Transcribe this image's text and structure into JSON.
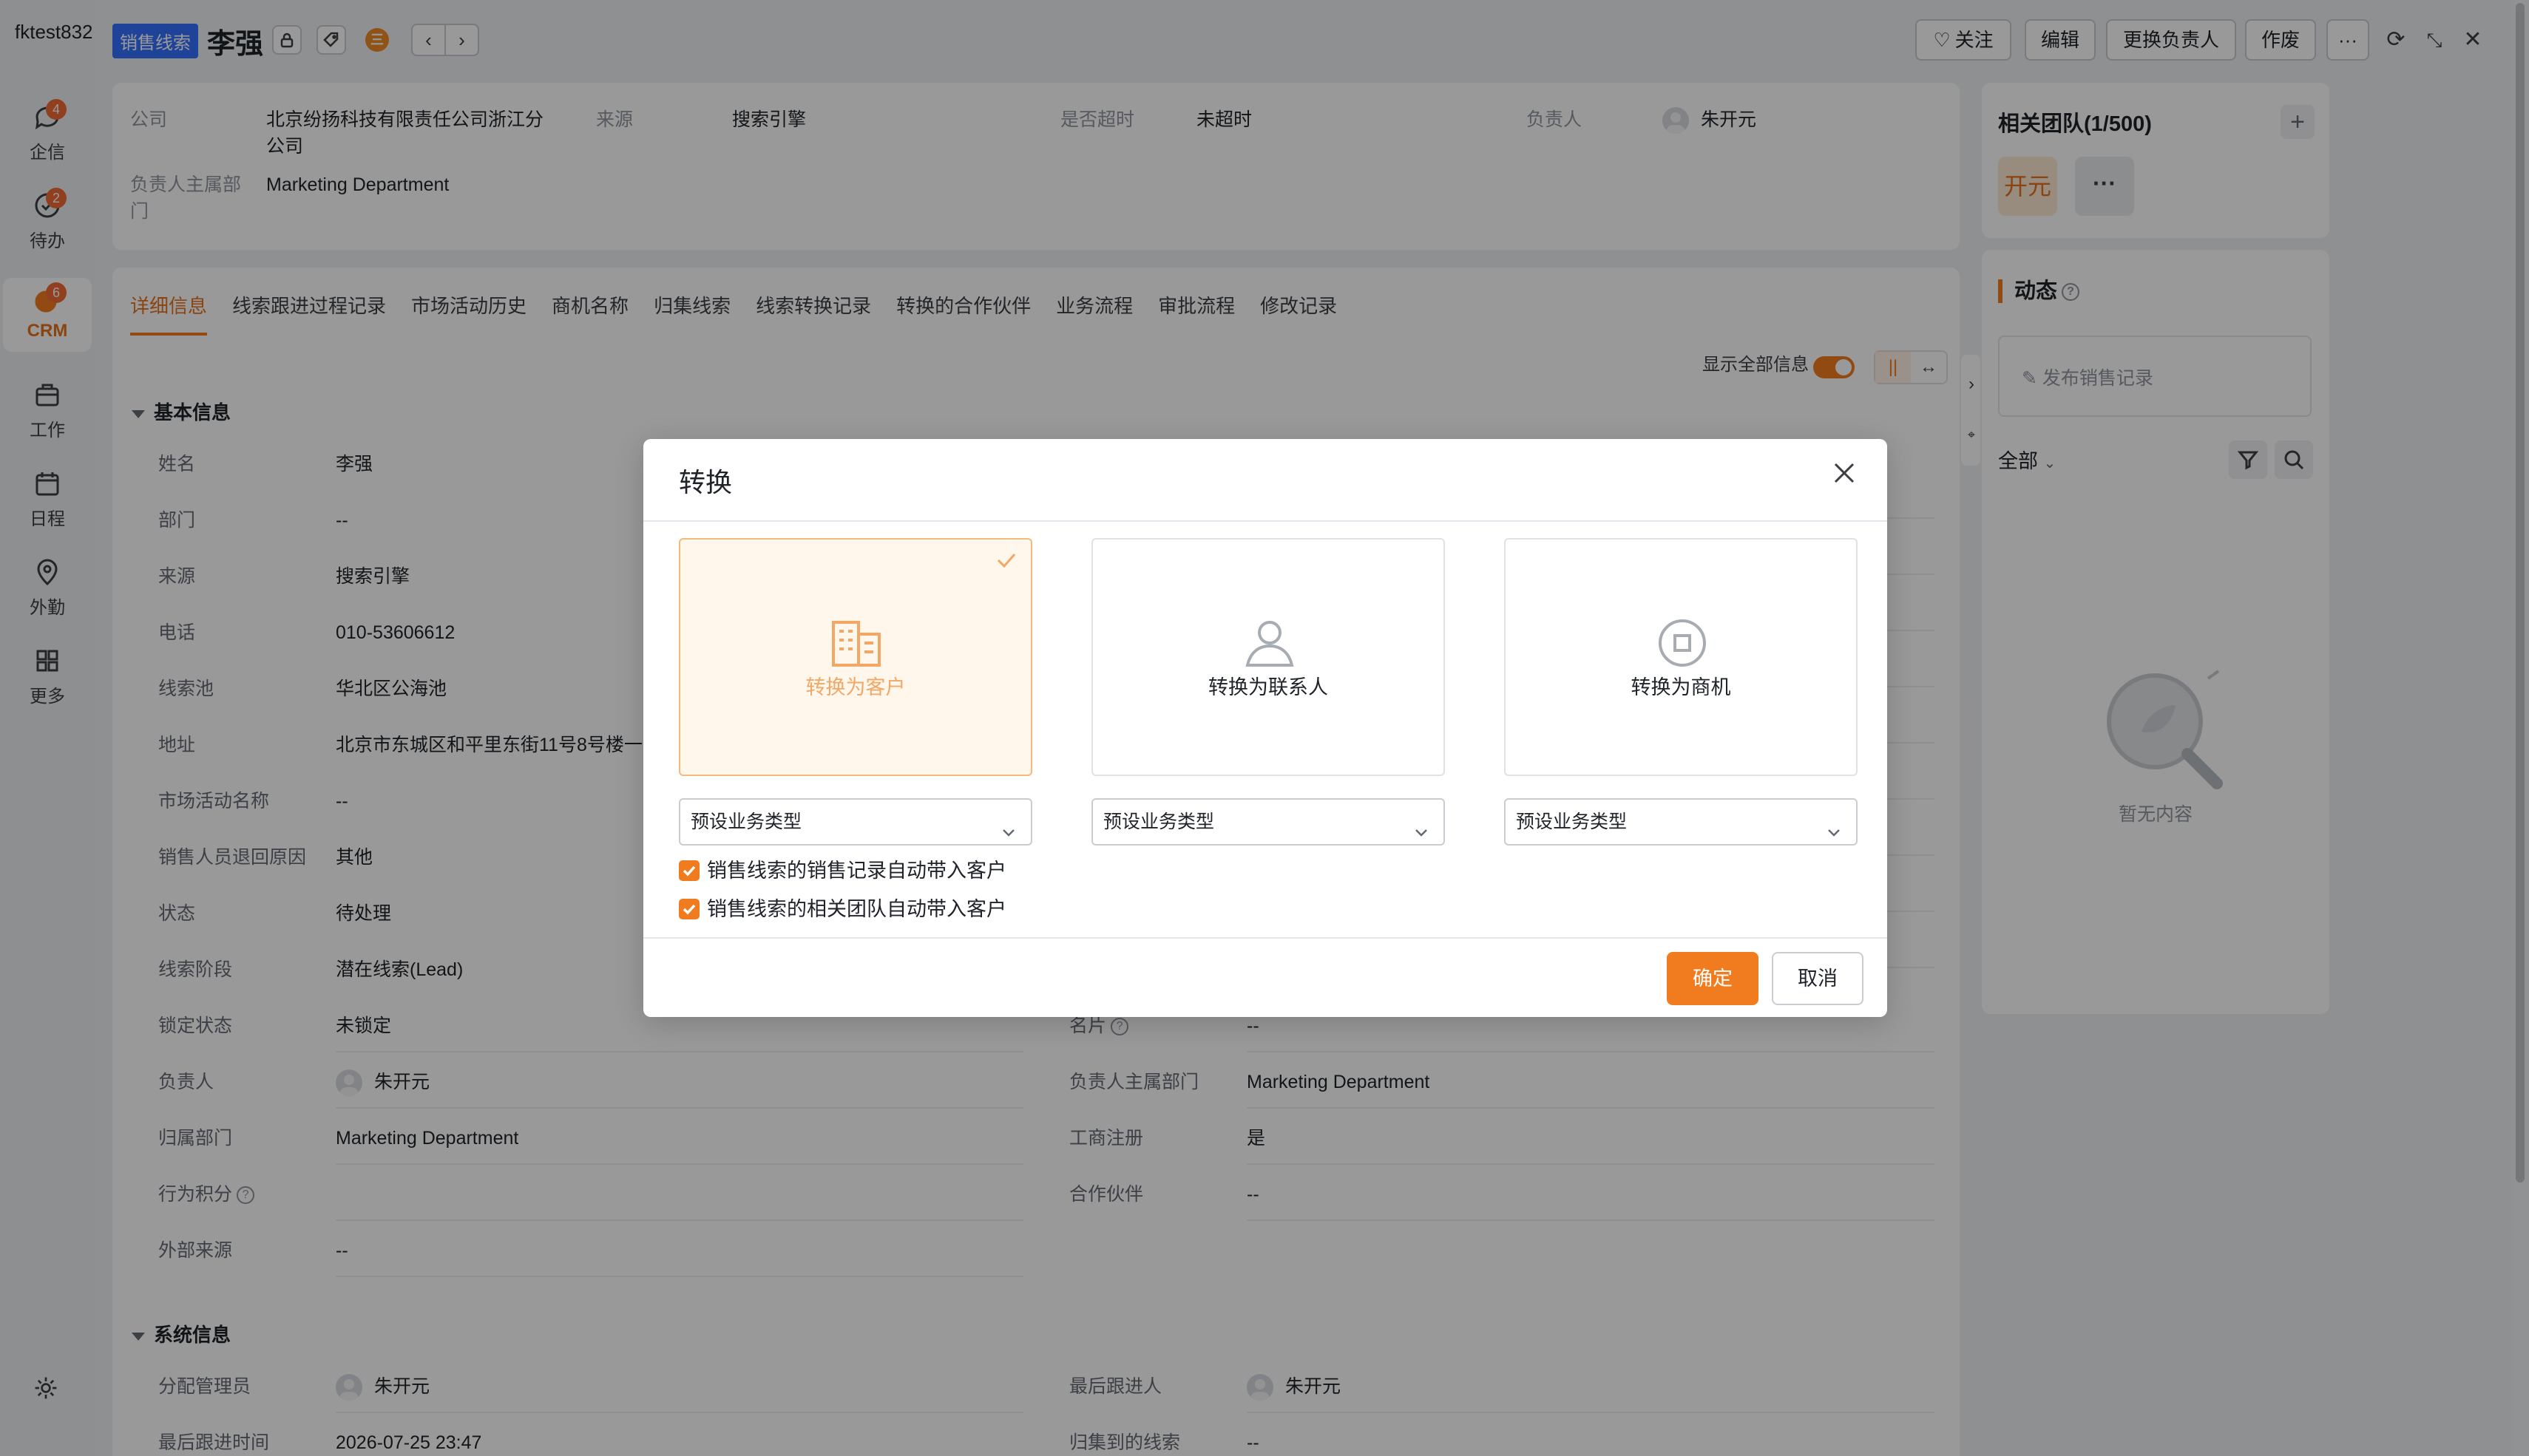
{
  "nav": {
    "tenant": "fktest832",
    "items": [
      {
        "label": "企信",
        "badge": "4"
      },
      {
        "label": "待办",
        "badge": "2"
      },
      {
        "label": "CRM",
        "badge": "6"
      },
      {
        "label": "工作",
        "badge": ""
      },
      {
        "label": "日程",
        "badge": ""
      },
      {
        "label": "外勤",
        "badge": ""
      },
      {
        "label": "更多",
        "badge": ""
      }
    ]
  },
  "header": {
    "tag": "销售线索",
    "name": "李强",
    "coin": "三",
    "prev": "‹",
    "next": "›",
    "follow": "关注",
    "edit": "编辑",
    "change_owner": "更换负责人",
    "void": "作废",
    "more": "···"
  },
  "summary": {
    "company_label": "公司",
    "company_value": "北京纷扬科技有限责任公司浙江分公司",
    "source_label": "来源",
    "source_value": "搜索引擎",
    "overdue_label": "是否超时",
    "overdue_value": "未超时",
    "owner_label": "负责人",
    "owner_value": "朱开元",
    "dept_label": "负责人主属部门",
    "dept_value": "Marketing Department"
  },
  "tabs": [
    "详细信息",
    "线索跟进过程记录",
    "市场活动历史",
    "商机名称",
    "归集线索",
    "线索转换记录",
    "转换的合作伙伴",
    "业务流程",
    "审批流程",
    "修改记录"
  ],
  "toolbar": {
    "show_all": "显示全部信息",
    "layout_a": "||",
    "layout_b": "↔"
  },
  "basic": {
    "title": "基本信息",
    "left": [
      {
        "label": "姓名",
        "value": "李强"
      },
      {
        "label": "部门",
        "value": "--"
      },
      {
        "label": "来源",
        "value": "搜索引擎"
      },
      {
        "label": "电话",
        "value": "010-53606612"
      },
      {
        "label": "线索池",
        "value": "华北区公海池"
      },
      {
        "label": "地址",
        "value": "北京市东城区和平里东街11号8号楼一"
      },
      {
        "label": "市场活动名称",
        "value": "--"
      },
      {
        "label": "销售人员退回原因",
        "value": "其他"
      },
      {
        "label": "状态",
        "value": "待处理"
      },
      {
        "label": "线索阶段",
        "value": "潜在线索(Lead)"
      },
      {
        "label": "锁定状态",
        "value": "未锁定"
      },
      {
        "label": "负责人",
        "value": "朱开元"
      },
      {
        "label": "归属部门",
        "value": "Marketing Department"
      },
      {
        "label": "行为积分",
        "value": ""
      },
      {
        "label": "外部来源",
        "value": "--"
      }
    ],
    "right": [
      {
        "label": "名片",
        "value": "--"
      },
      {
        "label": "负责人主属部门",
        "value": "Marketing Department"
      },
      {
        "label": "工商注册",
        "value": "是"
      },
      {
        "label": "合作伙伴",
        "value": "--"
      }
    ]
  },
  "system": {
    "title": "系统信息",
    "rows": [
      {
        "label": "分配管理员",
        "value": "朱开元"
      },
      {
        "label": "最后跟进人",
        "value": "朱开元"
      },
      {
        "label": "最后跟进时间",
        "value": "2026-07-25 23:47"
      },
      {
        "label": "归集到的线索",
        "value": "--"
      }
    ]
  },
  "team": {
    "title": "相关团队(1/500)",
    "member": "开元",
    "more": "···",
    "add": "+"
  },
  "dynamics": {
    "title": "动态",
    "post": "发布销售记录",
    "filter": "全部",
    "empty": "暂无内容"
  },
  "modal": {
    "title": "转换",
    "options": [
      {
        "label": "转换为客户",
        "selected": true
      },
      {
        "label": "转换为联系人",
        "selected": false
      },
      {
        "label": "转换为商机",
        "selected": false
      }
    ],
    "select_placeholder": "预设业务类型",
    "checks": [
      "销售线索的销售记录自动带入客户",
      "销售线索的相关团队自动带入客户"
    ],
    "ok": "确定",
    "cancel": "取消"
  },
  "colors": {
    "accent": "#f07c1f",
    "tag_blue": "#3370ff"
  }
}
